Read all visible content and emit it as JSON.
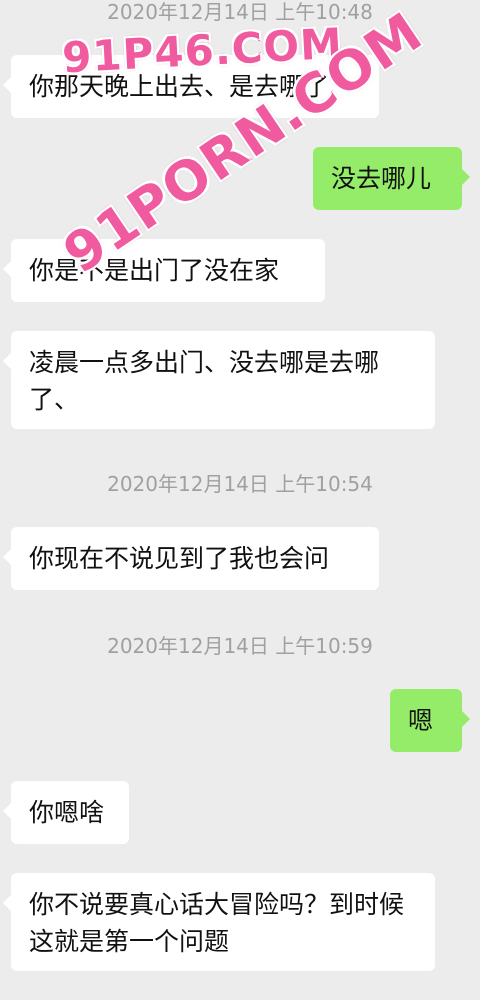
{
  "messages": [
    {
      "type": "timestamp",
      "text": "2020年12月14日 上午10:48"
    },
    {
      "type": "left",
      "text": "你那天晚上出去、是去哪了"
    },
    {
      "type": "right",
      "text": "没去哪儿"
    },
    {
      "type": "left",
      "text": "你是不是出门了没在家"
    },
    {
      "type": "left",
      "text": "凌晨一点多出门、没去哪是去哪了、"
    },
    {
      "type": "timestamp",
      "text": "2020年12月14日 上午10:54"
    },
    {
      "type": "left",
      "text": "你现在不说见到了我也会问"
    },
    {
      "type": "timestamp",
      "text": "2020年12月14日 上午10:59"
    },
    {
      "type": "right",
      "text": "嗯"
    },
    {
      "type": "left",
      "text": "你嗯啥"
    },
    {
      "type": "left",
      "text": "你不说要真心话大冒险吗？到时候这就是第一个问题"
    }
  ],
  "watermarks": [
    "91P46.COM",
    "91PORN.COM"
  ],
  "colors": {
    "background": "#ececec",
    "left_bubble": "#ffffff",
    "right_bubble": "#95ec69",
    "timestamp": "#a0a0a0",
    "watermark": "#f05ba0"
  }
}
